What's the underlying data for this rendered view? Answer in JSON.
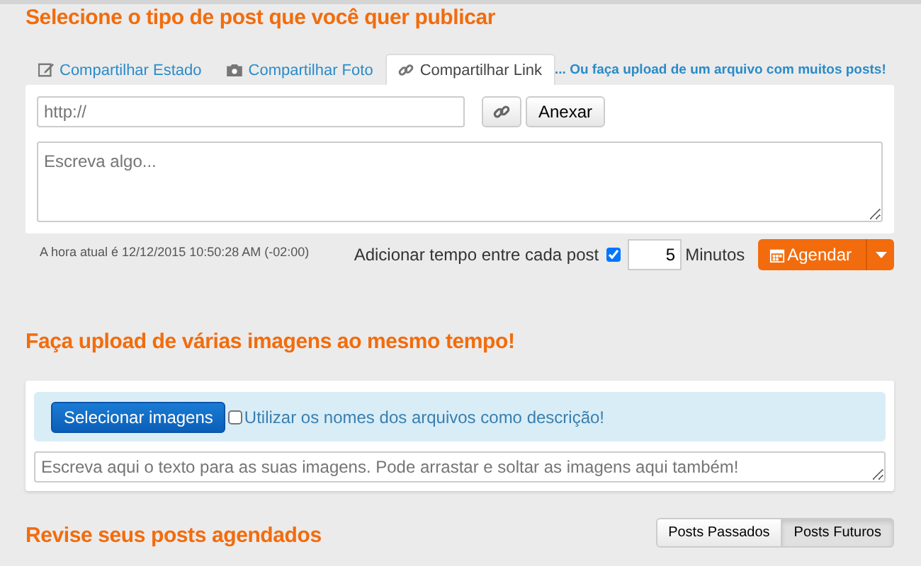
{
  "post_section": {
    "heading": "Selecione o tipo de post que você quer publicar",
    "tabs": [
      {
        "label": "Compartilhar Estado",
        "kind": "status",
        "selected": false
      },
      {
        "label": "Compartilhar Foto",
        "kind": "photo",
        "selected": false
      },
      {
        "label": "Compartilhar Link",
        "kind": "link",
        "selected": true
      }
    ],
    "upload_link": "... Ou faça upload de um arquivo com muitos posts!",
    "url_field": {
      "placeholder": "http://"
    },
    "attach_button": "Anexar",
    "message_field": {
      "placeholder": "Escreva algo..."
    },
    "current_time": "A hora atual é 12/12/2015 10:50:28 AM (-02:00)",
    "interval": {
      "label": "Adicionar tempo entre cada post",
      "checked": true,
      "value": "5",
      "unit": "Minutos"
    },
    "schedule_button": "Agendar"
  },
  "upload_section": {
    "heading": "Faça upload de várias imagens ao mesmo tempo!",
    "select_button": "Selecionar imagens",
    "filenames_option": {
      "label": "Utilizar os nomes dos arquivos como descrição!",
      "checked": false
    },
    "text_field": {
      "placeholder": "Escreva aqui o texto para as suas imagens. Pode arrastar e soltar as imagens aqui também!"
    }
  },
  "review_section": {
    "heading": "Revise seus posts agendados",
    "toggle": [
      {
        "label": "Posts Passados",
        "selected": false
      },
      {
        "label": "Posts Futuros",
        "selected": true
      }
    ]
  }
}
